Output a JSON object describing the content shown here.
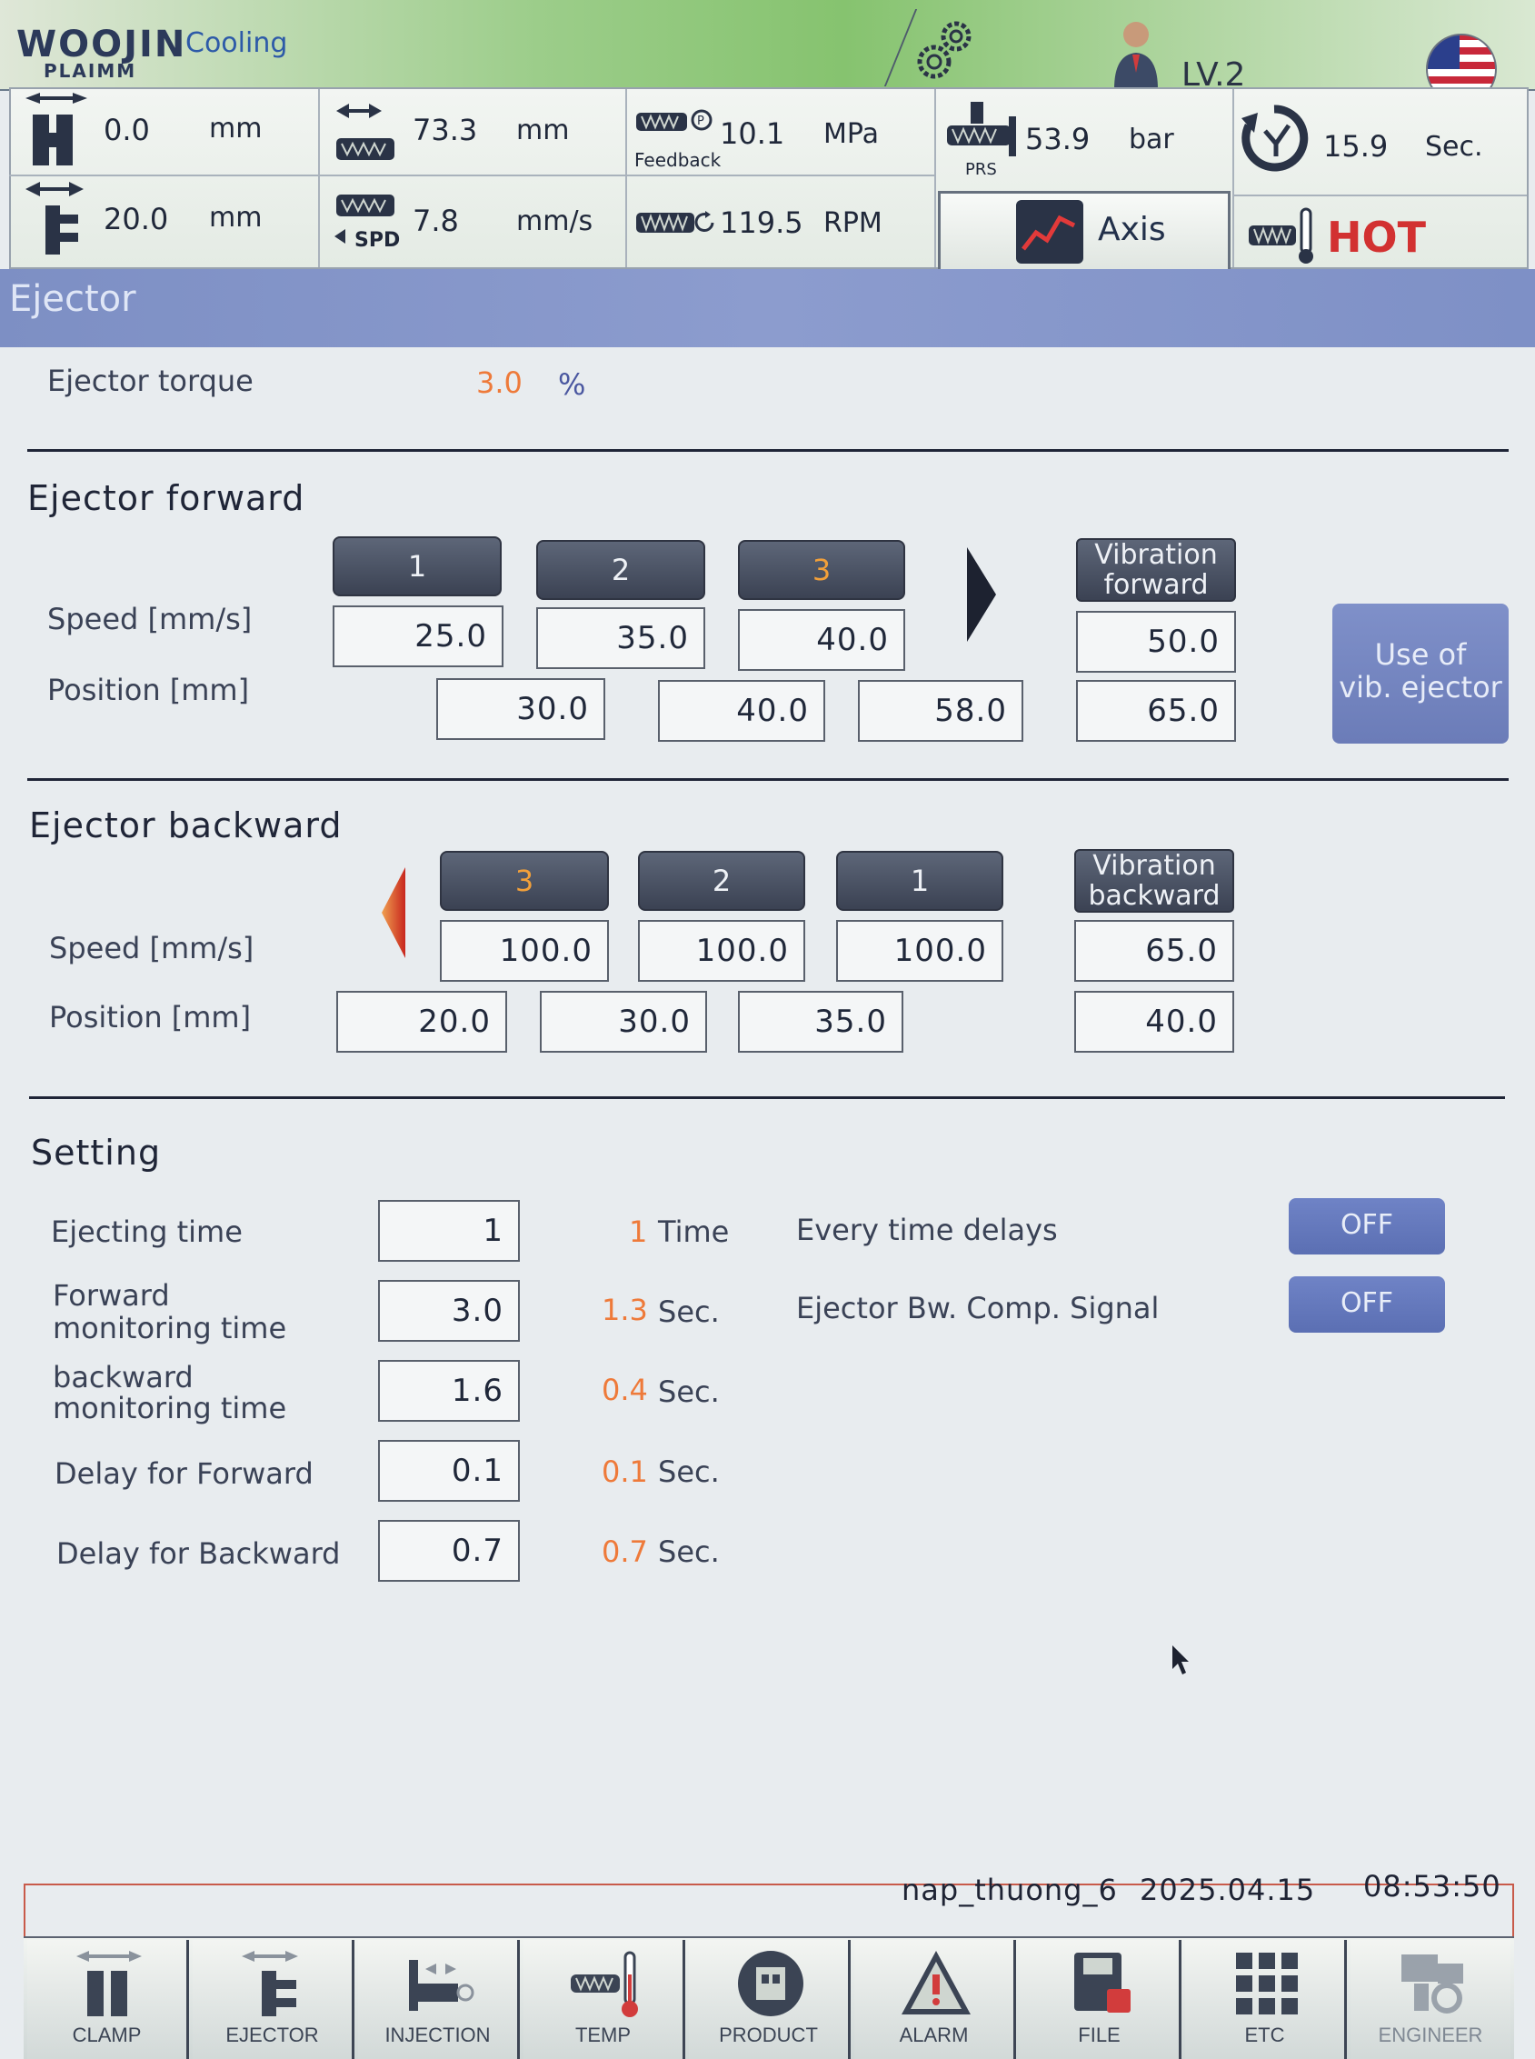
{
  "header": {
    "brand": "WOOJIN",
    "brand_sub": "PLAIMM",
    "mode": "Cooling",
    "level": "LV.2"
  },
  "status": {
    "clamp_pos": {
      "value": "0.0",
      "unit": "mm"
    },
    "ejector_pos": {
      "value": "20.0",
      "unit": "mm"
    },
    "screw_pos": {
      "value": "73.3",
      "unit": "mm"
    },
    "screw_speed": {
      "value": "7.8",
      "unit": "mm/s",
      "label": "SPD"
    },
    "pressure": {
      "value": "10.1",
      "unit": "MPa",
      "label": "Feedback"
    },
    "rpm": {
      "value": "119.5",
      "unit": "RPM"
    },
    "prs": {
      "value": "53.9",
      "unit": "bar",
      "label": "PRS"
    },
    "cycle": {
      "value": "15.9",
      "unit": "Sec."
    },
    "axis_label": "Axis",
    "hot_label": "HOT"
  },
  "page_title": "Ejector",
  "torque": {
    "label": "Ejector torque",
    "value": "3.0",
    "unit": "%"
  },
  "forward": {
    "title": "Ejector forward",
    "speed_label": "Speed [mm/s]",
    "position_label": "Position [mm]",
    "steps": [
      "1",
      "2",
      "3"
    ],
    "speeds": [
      "25.0",
      "35.0",
      "40.0"
    ],
    "positions": [
      "30.0",
      "40.0",
      "58.0"
    ],
    "vib_label_1": "Vibration",
    "vib_label_2": "forward",
    "vib_speed": "50.0",
    "vib_position": "65.0",
    "use_vib_1": "Use of",
    "use_vib_2": "vib. ejector"
  },
  "backward": {
    "title": "Ejector backward",
    "speed_label": "Speed [mm/s]",
    "position_label": "Position [mm]",
    "steps": [
      "3",
      "2",
      "1"
    ],
    "speeds": [
      "100.0",
      "100.0",
      "100.0"
    ],
    "positions": [
      "20.0",
      "30.0",
      "35.0"
    ],
    "vib_label_1": "Vibration",
    "vib_label_2": "backward",
    "vib_speed": "65.0",
    "vib_position": "40.0"
  },
  "setting": {
    "title": "Setting",
    "rows": [
      {
        "label_1": "Ejecting time",
        "label_2": "",
        "value": "1",
        "actual": "1",
        "unit": "Time"
      },
      {
        "label_1": "Forward",
        "label_2": "monitoring time",
        "value": "3.0",
        "actual": "1.3",
        "unit": "Sec."
      },
      {
        "label_1": "backward",
        "label_2": "monitoring time",
        "value": "1.6",
        "actual": "0.4",
        "unit": "Sec."
      },
      {
        "label_1": "Delay for Forward",
        "label_2": "",
        "value": "0.1",
        "actual": "0.1",
        "unit": "Sec."
      },
      {
        "label_1": "Delay for Backward",
        "label_2": "",
        "value": "0.7",
        "actual": "0.7",
        "unit": "Sec."
      }
    ],
    "every_time_delays": {
      "label": "Every time delays",
      "state": "OFF"
    },
    "comp_signal": {
      "label": "Ejector Bw. Comp. Signal",
      "state": "OFF"
    }
  },
  "footer": {
    "mold_name": "nap_thuong_6",
    "date": "2025.04.15",
    "time": "08:53:50"
  },
  "nav": [
    {
      "label": "CLAMP",
      "icon": "clamp-icon"
    },
    {
      "label": "EJECTOR",
      "icon": "ejector-icon"
    },
    {
      "label": "INJECTION",
      "icon": "injection-icon"
    },
    {
      "label": "TEMP",
      "icon": "temp-icon"
    },
    {
      "label": "PRODUCT",
      "icon": "product-icon"
    },
    {
      "label": "ALARM",
      "icon": "alarm-icon"
    },
    {
      "label": "FILE",
      "icon": "file-icon"
    },
    {
      "label": "ETC",
      "icon": "etc-icon"
    },
    {
      "label": "ENGINEER",
      "icon": "engineer-icon"
    }
  ],
  "colors": {
    "accent_orange": "#ee7a3a",
    "title_band": "#8596cb",
    "hot_red": "#d23131",
    "off_button": "#6478bb"
  }
}
